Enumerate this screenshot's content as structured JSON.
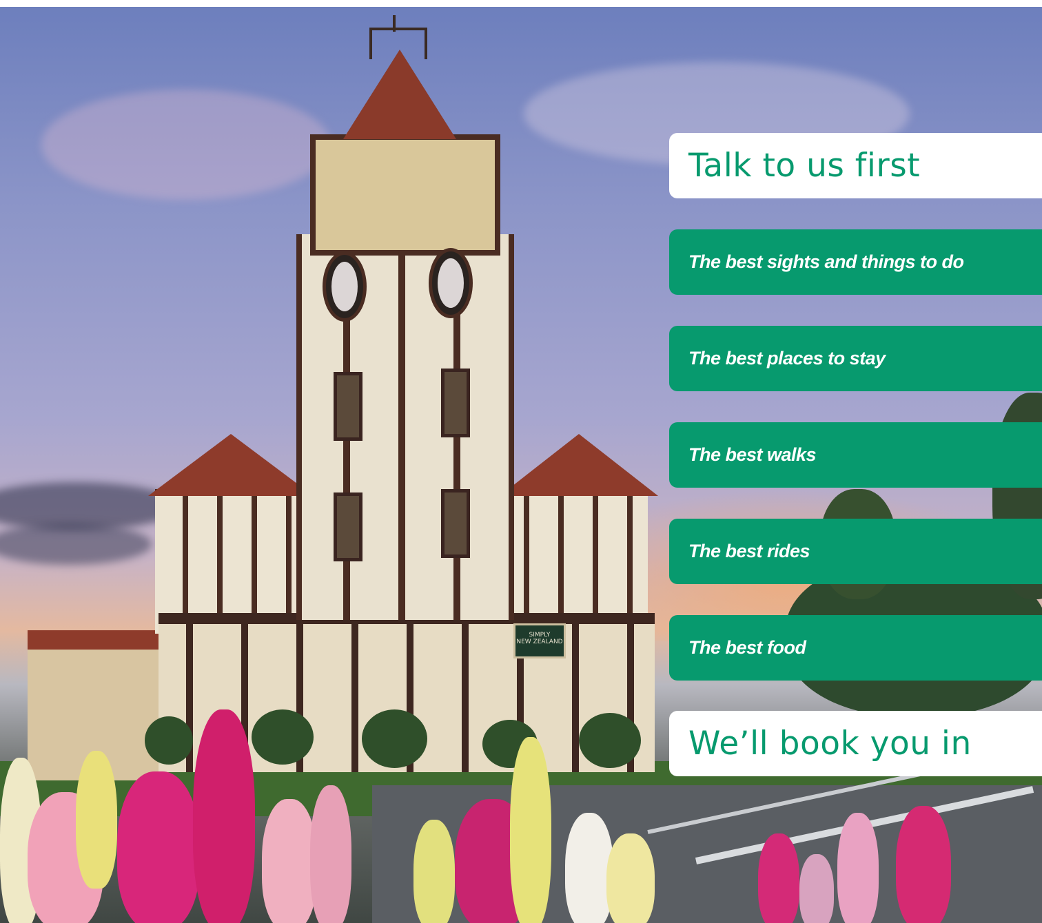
{
  "panels": {
    "heading_top": "Talk to us first",
    "items": [
      "The best sights and things to do",
      "The best places to stay",
      "The best walks",
      "The best rides",
      "The best food"
    ],
    "heading_bottom": "We’ll book you in"
  },
  "building_sign": {
    "line1": "SIMPLY",
    "line2": "NEW ZEALAND"
  },
  "colors": {
    "accent_green": "#079a6e",
    "panel_white": "#ffffff"
  }
}
